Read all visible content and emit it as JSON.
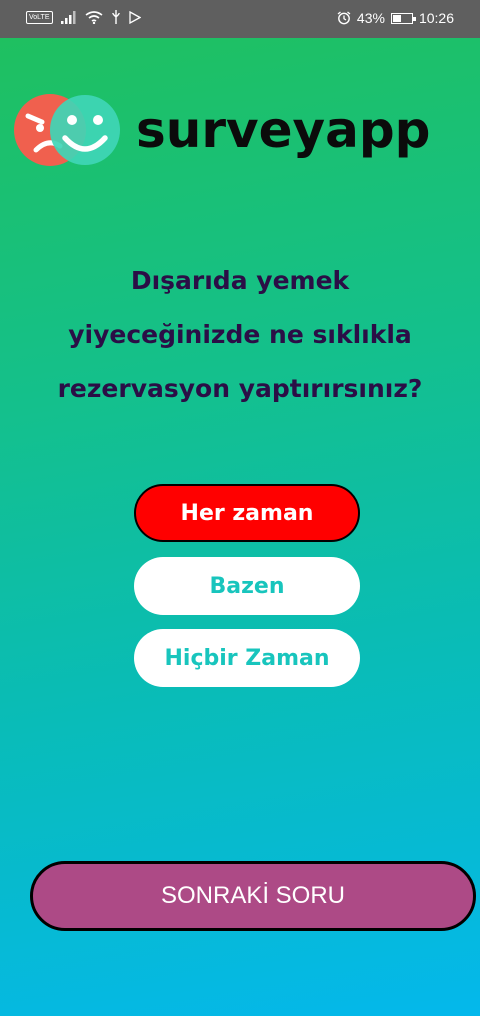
{
  "status_bar": {
    "volte": "VoLTE",
    "icons_left": [
      "signal-icon",
      "wifi-icon",
      "usb-icon",
      "play-store-icon"
    ],
    "alarm_icon": "alarm-icon",
    "battery_percent": "43%",
    "battery_level": 0.43,
    "time": "10:26"
  },
  "brand": {
    "name": "surveyapp",
    "logo": "angry-and-happy-faces-logo"
  },
  "question": {
    "lines": [
      "Dışarıda yemek",
      "yiyeceğinizde ne sıklıkla",
      "rezervasyon yaptırırsınız?"
    ]
  },
  "options": [
    {
      "label": "Her zaman",
      "selected": true
    },
    {
      "label": "Bazen",
      "selected": false
    },
    {
      "label": "Hiçbir Zaman",
      "selected": false
    }
  ],
  "next_button": {
    "label": "SONRAKİ SORU"
  },
  "colors": {
    "gradient_top": "#1fc060",
    "gradient_bottom": "#04b8ec",
    "question_text": "#2b0e46",
    "selected_option": "#ff0000",
    "option_text": "#18c5bd",
    "next_button": "#ad4a86",
    "logo_red": "#f0604e",
    "logo_teal": "#3fd6b6"
  }
}
